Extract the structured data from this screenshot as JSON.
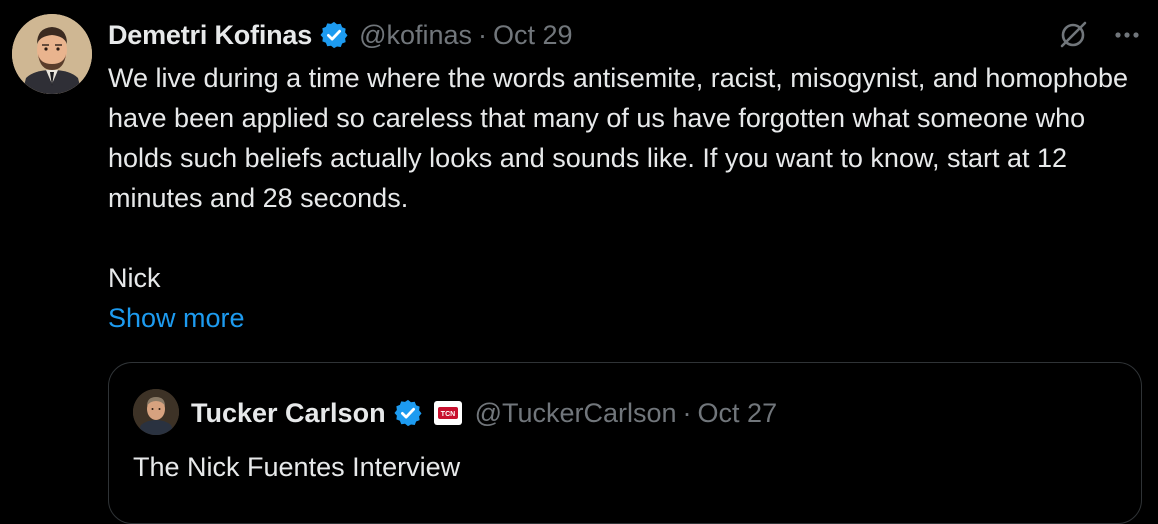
{
  "author": {
    "display_name": "Demetri Kofinas",
    "handle": "@kofinas",
    "separator": "·",
    "date": "Oct 29"
  },
  "tweet": {
    "paragraph_1": "We live during a time where the words antisemite, racist, misogynist, and homophobe have been applied so careless that many of us have forgotten what someone who holds such beliefs actually looks and sounds like. If you want to know, start at 12 minutes and 28 seconds.",
    "paragraph_2": "Nick",
    "show_more_label": "Show more"
  },
  "quoted_tweet": {
    "display_name": "Tucker Carlson",
    "handle": "@TuckerCarlson",
    "separator": "·",
    "date": "Oct 27",
    "text": "The Nick Fuentes Interview",
    "affiliate_badge_text": "TCN"
  },
  "icons": {
    "verified": "verified-badge-icon",
    "grok": "grok-icon",
    "more": "more-icon"
  },
  "colors": {
    "background": "#000000",
    "primary_text": "#e7e9ea",
    "secondary_text": "#71767b",
    "link": "#1d9bf0",
    "verified_blue": "#1d9bf0",
    "border": "#2f3336"
  }
}
